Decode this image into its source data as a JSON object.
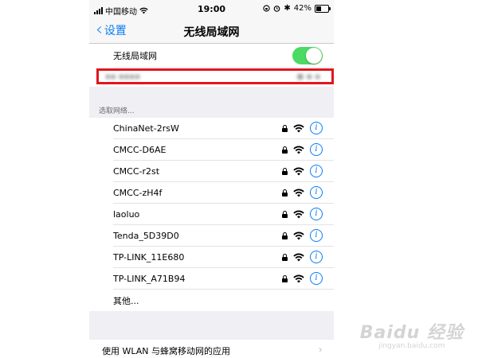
{
  "status_bar": {
    "carrier": "中国移动",
    "time": "19:00",
    "battery": "42%",
    "battery_level": 0.42
  },
  "nav": {
    "back_label": "设置",
    "title": "无线局域网"
  },
  "wlan": {
    "label": "无线局域网",
    "enabled": true
  },
  "section_header": "选取网络...",
  "networks": [
    {
      "name": "ChinaNet-2rsW",
      "locked": true
    },
    {
      "name": "CMCC-D6AE",
      "locked": true
    },
    {
      "name": "CMCC-r2st",
      "locked": true
    },
    {
      "name": "CMCC-zH4f",
      "locked": true
    },
    {
      "name": "laoluo",
      "locked": true
    },
    {
      "name": "Tenda_5D39D0",
      "locked": true
    },
    {
      "name": "TP-LINK_11E680",
      "locked": true
    },
    {
      "name": "TP-LINK_A71B94",
      "locked": true
    }
  ],
  "other_label": "其他...",
  "bottom_row_label": "使用 WLAN 与蜂窝移动网的应用",
  "watermark": {
    "line1": "Baidu 经验",
    "line2": "jingyan.baidu.com"
  },
  "colors": {
    "accent": "#0a7cf6",
    "toggle_on": "#4cd964",
    "highlight": "#e0161e"
  }
}
